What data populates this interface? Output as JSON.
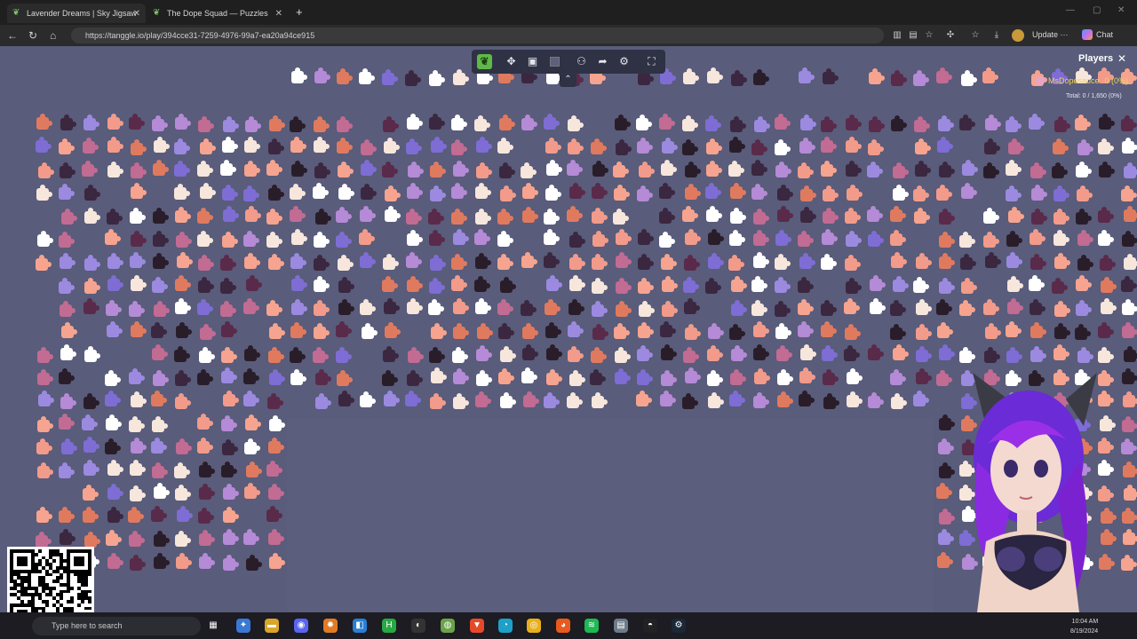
{
  "browser": {
    "tabs": [
      {
        "title": "Lavender Dreams | Sky Jigsaw",
        "active": true
      },
      {
        "title": "The Dope Squad — Puzzles",
        "active": false
      }
    ],
    "url": "https://tanggle.io/play/394cce31-7259-4976-99a7-ea20a94ce915",
    "update_label": "Update",
    "chat_label": "Chat"
  },
  "toolbar": {
    "tools": [
      "logo-icon",
      "scatter-icon",
      "image-preview-icon",
      "background-color-icon",
      "players-icon",
      "share-icon",
      "settings-icon",
      "fullscreen-icon"
    ],
    "collapse_icon": "chevron-up-icon"
  },
  "players_panel": {
    "title": "Players",
    "players": [
      {
        "name": "MsDopesauce",
        "score": "0 (0%)"
      }
    ],
    "total": "Total: 0 / 1,650 (0%)"
  },
  "taskbar": {
    "search_placeholder": "Type here to search",
    "clock_time": "10:04 AM",
    "clock_date": "8/19/2024"
  },
  "colors": {
    "canvas_bg": "#595c7a",
    "piece_palette": [
      "#f29b8a",
      "#f6a48f",
      "#ffffff",
      "#f7e6dc",
      "#9b8ae0",
      "#7e6dd4",
      "#2a1d2a",
      "#5a2a4a",
      "#c26b93",
      "#e07a5f",
      "#b58ad6",
      "#3b2740"
    ]
  }
}
